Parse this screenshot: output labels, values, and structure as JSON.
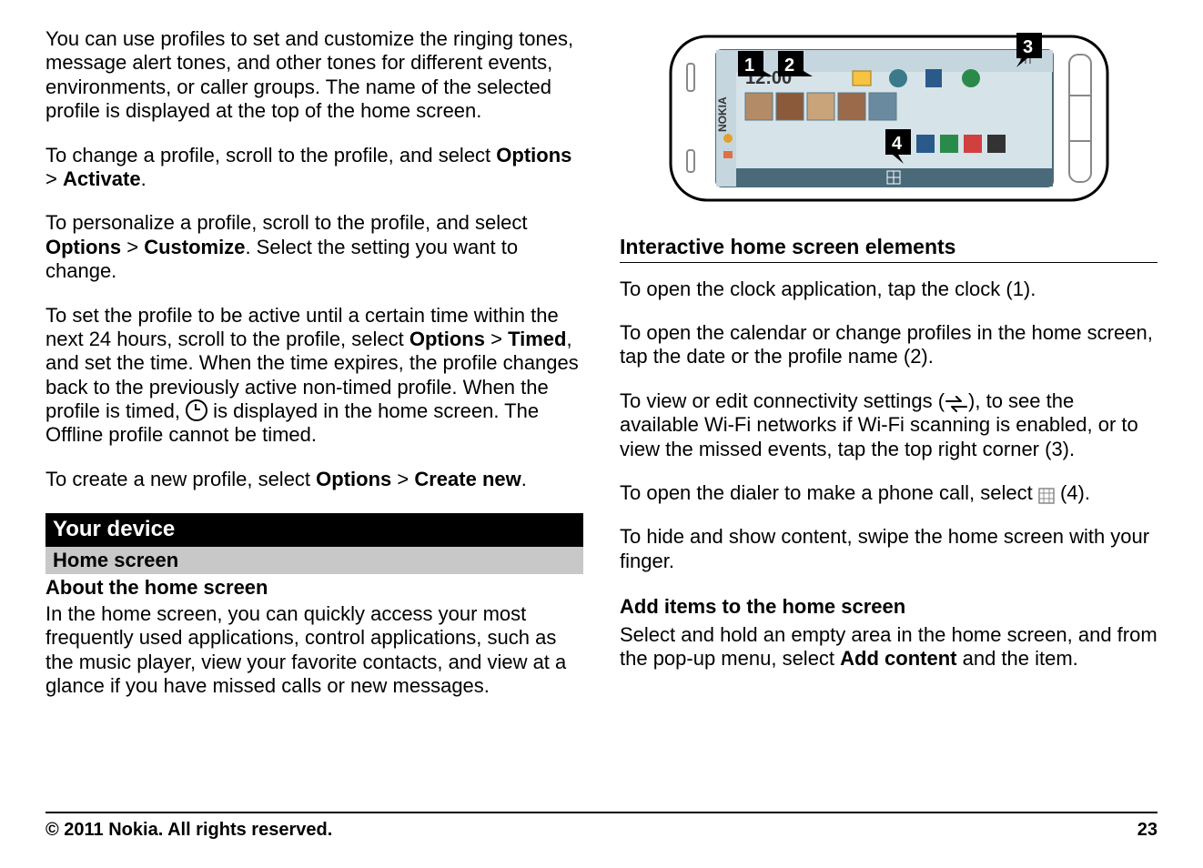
{
  "left": {
    "p1": "You can use profiles to set and customize the ringing tones, message alert tones, and other tones for different events, environments, or caller groups. The name of the selected profile is displayed at the top of the home screen.",
    "p2_a": "To change a profile, scroll to the profile, and select ",
    "p2_b": "Options",
    "p2_c": " > ",
    "p2_d": "Activate",
    "p2_e": ".",
    "p3_a": "To personalize a profile, scroll to the profile, and select ",
    "p3_b": "Options",
    "p3_c": " > ",
    "p3_d": "Customize",
    "p3_e": ". Select the setting you want to change.",
    "p4_a": "To set the profile to be active until a certain time within the next 24 hours, scroll to the profile, select ",
    "p4_b": "Options",
    "p4_c": " > ",
    "p4_d": "Timed",
    "p4_e": ", and set the time. When the time expires, the profile changes back to the previously active non-timed profile. When the profile is timed, ",
    "p4_f": " is displayed in the home screen. The Offline profile cannot be timed.",
    "p5_a": "To create a new profile, select ",
    "p5_b": "Options",
    "p5_c": " > ",
    "p5_d": "Create new",
    "p5_e": ".",
    "band": "Your device",
    "sub": "Home screen",
    "subt": "About the home screen",
    "p6": "In the home screen, you can quickly access your most frequently used applications, control applications, such as the music player, view your favorite contacts, and view at a glance if you have missed calls or new messages."
  },
  "right": {
    "callouts": {
      "c1": "1",
      "c2": "2",
      "c3": "3",
      "c4": "4"
    },
    "phone_time": "12:00",
    "h3": "Interactive home screen elements",
    "p1": "To open the clock application, tap the clock (1).",
    "p2": "To open the calendar or change profiles in the home screen, tap the date or the profile name (2).",
    "p3_a": "To view or edit connectivity settings (",
    "p3_b": "), to see the available Wi-Fi networks if Wi-Fi scanning is enabled, or to view the missed events, tap the top right corner (3).",
    "p4_a": "To open the dialer to make a phone call, select ",
    "p4_b": " (4).",
    "p5": "To hide and show content, swipe the home screen with your finger.",
    "h4": "Add items to the home screen",
    "p6_a": "Select and hold an empty area in the home screen, and from the pop-up menu, select ",
    "p6_b": "Add content",
    "p6_c": " and the item."
  },
  "footer": {
    "copy": "© 2011 Nokia. All rights reserved.",
    "page": "23"
  }
}
